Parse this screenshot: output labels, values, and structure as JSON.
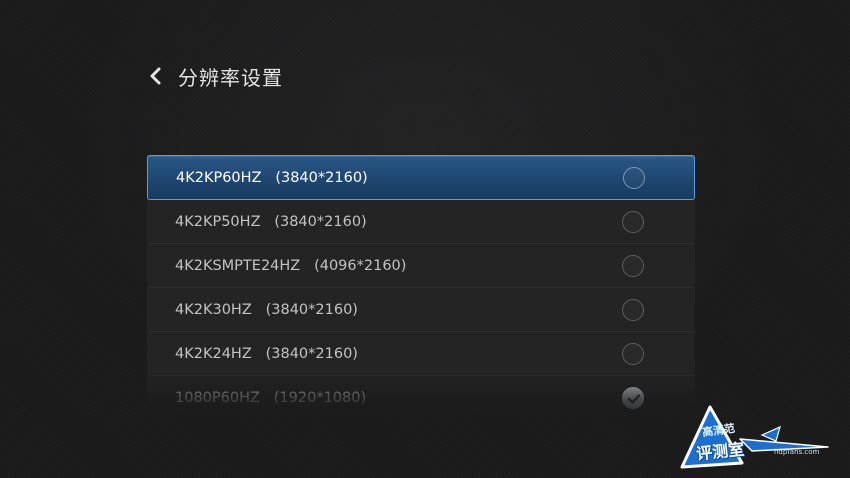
{
  "header": {
    "title": "分辨率设置",
    "back_icon": "chevron-left-icon"
  },
  "resolutions": [
    {
      "name": "4K2KP60HZ",
      "resolution": "(3840*2160)",
      "selected": true,
      "checked": false
    },
    {
      "name": "4K2KP50HZ",
      "resolution": "(3840*2160)",
      "selected": false,
      "checked": false
    },
    {
      "name": "4K2KSMPTE24HZ",
      "resolution": "(4096*2160)",
      "selected": false,
      "checked": false
    },
    {
      "name": "4K2K30HZ",
      "resolution": "(3840*2160)",
      "selected": false,
      "checked": false
    },
    {
      "name": "4K2K24HZ",
      "resolution": "(3840*2160)",
      "selected": false,
      "checked": false
    },
    {
      "name": "1080P60HZ",
      "resolution": "(1920*1080)",
      "selected": false,
      "checked": true
    }
  ],
  "watermark": {
    "line1": "高清范",
    "line2": "评测室",
    "url": "hdpfans.com"
  },
  "colors": {
    "accent": "#2a5888",
    "highlight_border": "#5a9ae0",
    "watermark_blue": "#1a6fd1"
  }
}
